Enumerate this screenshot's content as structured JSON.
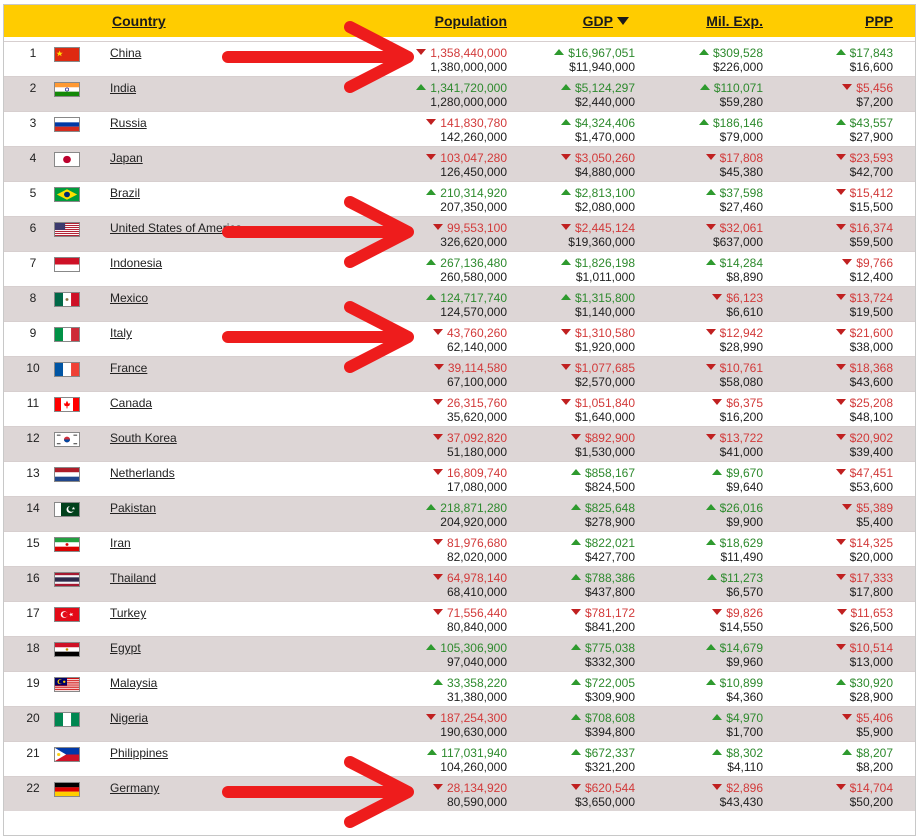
{
  "header": {
    "country": "Country",
    "population": "Population",
    "gdp": "GDP",
    "mil": "Mil. Exp.",
    "ppp": "PPP"
  },
  "colors": {
    "header_bg": "#ffcc00",
    "up": "#2e8a2e",
    "down": "#d23a3a",
    "annotation_arrow": "#ee1c1c"
  },
  "annotations": {
    "arrow_rows": [
      1,
      6,
      9,
      22
    ]
  },
  "rows": [
    {
      "rank": "1",
      "country": "China",
      "flag": "cn",
      "pop": {
        "dir": "down",
        "value": "1,358,440,000",
        "ref": "1,380,000,000"
      },
      "gdp": {
        "dir": "up",
        "value": "$16,967,051",
        "ref": "$11,940,000"
      },
      "mil": {
        "dir": "up",
        "value": "$309,528",
        "ref": "$226,000"
      },
      "ppp": {
        "dir": "up",
        "value": "$17,843",
        "ref": "$16,600"
      }
    },
    {
      "rank": "2",
      "country": "India",
      "flag": "in",
      "pop": {
        "dir": "up",
        "value": "1,341,720,000",
        "ref": "1,280,000,000"
      },
      "gdp": {
        "dir": "up",
        "value": "$5,124,297",
        "ref": "$2,440,000"
      },
      "mil": {
        "dir": "up",
        "value": "$110,071",
        "ref": "$59,280"
      },
      "ppp": {
        "dir": "down",
        "value": "$5,456",
        "ref": "$7,200"
      }
    },
    {
      "rank": "3",
      "country": "Russia",
      "flag": "ru",
      "pop": {
        "dir": "down",
        "value": "141,830,780",
        "ref": "142,260,000"
      },
      "gdp": {
        "dir": "up",
        "value": "$4,324,406",
        "ref": "$1,470,000"
      },
      "mil": {
        "dir": "up",
        "value": "$186,146",
        "ref": "$79,000"
      },
      "ppp": {
        "dir": "up",
        "value": "$43,557",
        "ref": "$27,900"
      }
    },
    {
      "rank": "4",
      "country": "Japan",
      "flag": "jp",
      "pop": {
        "dir": "down",
        "value": "103,047,280",
        "ref": "126,450,000"
      },
      "gdp": {
        "dir": "down",
        "value": "$3,050,260",
        "ref": "$4,880,000"
      },
      "mil": {
        "dir": "down",
        "value": "$17,808",
        "ref": "$45,380"
      },
      "ppp": {
        "dir": "down",
        "value": "$23,593",
        "ref": "$42,700"
      }
    },
    {
      "rank": "5",
      "country": "Brazil",
      "flag": "br",
      "pop": {
        "dir": "up",
        "value": "210,314,920",
        "ref": "207,350,000"
      },
      "gdp": {
        "dir": "up",
        "value": "$2,813,100",
        "ref": "$2,080,000"
      },
      "mil": {
        "dir": "up",
        "value": "$37,598",
        "ref": "$27,460"
      },
      "ppp": {
        "dir": "down",
        "value": "$15,412",
        "ref": "$15,500"
      }
    },
    {
      "rank": "6",
      "country": "United States of America",
      "flag": "us",
      "pop": {
        "dir": "down",
        "value": "99,553,100",
        "ref": "326,620,000"
      },
      "gdp": {
        "dir": "down",
        "value": "$2,445,124",
        "ref": "$19,360,000"
      },
      "mil": {
        "dir": "down",
        "value": "$32,061",
        "ref": "$637,000"
      },
      "ppp": {
        "dir": "down",
        "value": "$16,374",
        "ref": "$59,500"
      }
    },
    {
      "rank": "7",
      "country": "Indonesia",
      "flag": "id",
      "pop": {
        "dir": "up",
        "value": "267,136,480",
        "ref": "260,580,000"
      },
      "gdp": {
        "dir": "up",
        "value": "$1,826,198",
        "ref": "$1,011,000"
      },
      "mil": {
        "dir": "up",
        "value": "$14,284",
        "ref": "$8,890"
      },
      "ppp": {
        "dir": "down",
        "value": "$9,766",
        "ref": "$12,400"
      }
    },
    {
      "rank": "8",
      "country": "Mexico",
      "flag": "mx",
      "pop": {
        "dir": "up",
        "value": "124,717,740",
        "ref": "124,570,000"
      },
      "gdp": {
        "dir": "up",
        "value": "$1,315,800",
        "ref": "$1,140,000"
      },
      "mil": {
        "dir": "down",
        "value": "$6,123",
        "ref": "$6,610"
      },
      "ppp": {
        "dir": "down",
        "value": "$13,724",
        "ref": "$19,500"
      }
    },
    {
      "rank": "9",
      "country": "Italy",
      "flag": "it",
      "pop": {
        "dir": "down",
        "value": "43,760,260",
        "ref": "62,140,000"
      },
      "gdp": {
        "dir": "down",
        "value": "$1,310,580",
        "ref": "$1,920,000"
      },
      "mil": {
        "dir": "down",
        "value": "$12,942",
        "ref": "$28,990"
      },
      "ppp": {
        "dir": "down",
        "value": "$21,600",
        "ref": "$38,000"
      }
    },
    {
      "rank": "10",
      "country": "France",
      "flag": "fr",
      "pop": {
        "dir": "down",
        "value": "39,114,580",
        "ref": "67,100,000"
      },
      "gdp": {
        "dir": "down",
        "value": "$1,077,685",
        "ref": "$2,570,000"
      },
      "mil": {
        "dir": "down",
        "value": "$10,761",
        "ref": "$58,080"
      },
      "ppp": {
        "dir": "down",
        "value": "$18,368",
        "ref": "$43,600"
      }
    },
    {
      "rank": "11",
      "country": "Canada",
      "flag": "ca",
      "pop": {
        "dir": "down",
        "value": "26,315,760",
        "ref": "35,620,000"
      },
      "gdp": {
        "dir": "down",
        "value": "$1,051,840",
        "ref": "$1,640,000"
      },
      "mil": {
        "dir": "down",
        "value": "$6,375",
        "ref": "$16,200"
      },
      "ppp": {
        "dir": "down",
        "value": "$25,208",
        "ref": "$48,100"
      }
    },
    {
      "rank": "12",
      "country": "South Korea",
      "flag": "kr",
      "pop": {
        "dir": "down",
        "value": "37,092,820",
        "ref": "51,180,000"
      },
      "gdp": {
        "dir": "down",
        "value": "$892,900",
        "ref": "$1,530,000"
      },
      "mil": {
        "dir": "down",
        "value": "$13,722",
        "ref": "$41,000"
      },
      "ppp": {
        "dir": "down",
        "value": "$20,902",
        "ref": "$39,400"
      }
    },
    {
      "rank": "13",
      "country": "Netherlands",
      "flag": "nl",
      "pop": {
        "dir": "down",
        "value": "16,809,740",
        "ref": "17,080,000"
      },
      "gdp": {
        "dir": "up",
        "value": "$858,167",
        "ref": "$824,500"
      },
      "mil": {
        "dir": "up",
        "value": "$9,670",
        "ref": "$9,640"
      },
      "ppp": {
        "dir": "down",
        "value": "$47,451",
        "ref": "$53,600"
      }
    },
    {
      "rank": "14",
      "country": "Pakistan",
      "flag": "pk",
      "pop": {
        "dir": "up",
        "value": "218,871,280",
        "ref": "204,920,000"
      },
      "gdp": {
        "dir": "up",
        "value": "$825,648",
        "ref": "$278,900"
      },
      "mil": {
        "dir": "up",
        "value": "$26,016",
        "ref": "$9,900"
      },
      "ppp": {
        "dir": "down",
        "value": "$5,389",
        "ref": "$5,400"
      }
    },
    {
      "rank": "15",
      "country": "Iran",
      "flag": "ir",
      "pop": {
        "dir": "down",
        "value": "81,976,680",
        "ref": "82,020,000"
      },
      "gdp": {
        "dir": "up",
        "value": "$822,021",
        "ref": "$427,700"
      },
      "mil": {
        "dir": "up",
        "value": "$18,629",
        "ref": "$11,490"
      },
      "ppp": {
        "dir": "down",
        "value": "$14,325",
        "ref": "$20,000"
      }
    },
    {
      "rank": "16",
      "country": "Thailand",
      "flag": "th",
      "pop": {
        "dir": "down",
        "value": "64,978,140",
        "ref": "68,410,000"
      },
      "gdp": {
        "dir": "up",
        "value": "$788,386",
        "ref": "$437,800"
      },
      "mil": {
        "dir": "up",
        "value": "$11,273",
        "ref": "$6,570"
      },
      "ppp": {
        "dir": "down",
        "value": "$17,333",
        "ref": "$17,800"
      }
    },
    {
      "rank": "17",
      "country": "Turkey",
      "flag": "tr",
      "pop": {
        "dir": "down",
        "value": "71,556,440",
        "ref": "80,840,000"
      },
      "gdp": {
        "dir": "down",
        "value": "$781,172",
        "ref": "$841,200"
      },
      "mil": {
        "dir": "down",
        "value": "$9,826",
        "ref": "$14,550"
      },
      "ppp": {
        "dir": "down",
        "value": "$11,653",
        "ref": "$26,500"
      }
    },
    {
      "rank": "18",
      "country": "Egypt",
      "flag": "eg",
      "pop": {
        "dir": "up",
        "value": "105,306,900",
        "ref": "97,040,000"
      },
      "gdp": {
        "dir": "up",
        "value": "$775,038",
        "ref": "$332,300"
      },
      "mil": {
        "dir": "up",
        "value": "$14,679",
        "ref": "$9,960"
      },
      "ppp": {
        "dir": "down",
        "value": "$10,514",
        "ref": "$13,000"
      }
    },
    {
      "rank": "19",
      "country": "Malaysia",
      "flag": "my",
      "pop": {
        "dir": "up",
        "value": "33,358,220",
        "ref": "31,380,000"
      },
      "gdp": {
        "dir": "up",
        "value": "$722,005",
        "ref": "$309,900"
      },
      "mil": {
        "dir": "up",
        "value": "$10,899",
        "ref": "$4,360"
      },
      "ppp": {
        "dir": "up",
        "value": "$30,920",
        "ref": "$28,900"
      }
    },
    {
      "rank": "20",
      "country": "Nigeria",
      "flag": "ng",
      "pop": {
        "dir": "down",
        "value": "187,254,300",
        "ref": "190,630,000"
      },
      "gdp": {
        "dir": "up",
        "value": "$708,608",
        "ref": "$394,800"
      },
      "mil": {
        "dir": "up",
        "value": "$4,970",
        "ref": "$1,700"
      },
      "ppp": {
        "dir": "down",
        "value": "$5,406",
        "ref": "$5,900"
      }
    },
    {
      "rank": "21",
      "country": "Philippines",
      "flag": "ph",
      "pop": {
        "dir": "up",
        "value": "117,031,940",
        "ref": "104,260,000"
      },
      "gdp": {
        "dir": "up",
        "value": "$672,337",
        "ref": "$321,200"
      },
      "mil": {
        "dir": "up",
        "value": "$8,302",
        "ref": "$4,110"
      },
      "ppp": {
        "dir": "up",
        "value": "$8,207",
        "ref": "$8,200"
      }
    },
    {
      "rank": "22",
      "country": "Germany",
      "flag": "de",
      "pop": {
        "dir": "down",
        "value": "28,134,920",
        "ref": "80,590,000"
      },
      "gdp": {
        "dir": "down",
        "value": "$620,544",
        "ref": "$3,650,000"
      },
      "mil": {
        "dir": "down",
        "value": "$2,896",
        "ref": "$43,430"
      },
      "ppp": {
        "dir": "down",
        "value": "$14,704",
        "ref": "$50,200"
      }
    }
  ]
}
